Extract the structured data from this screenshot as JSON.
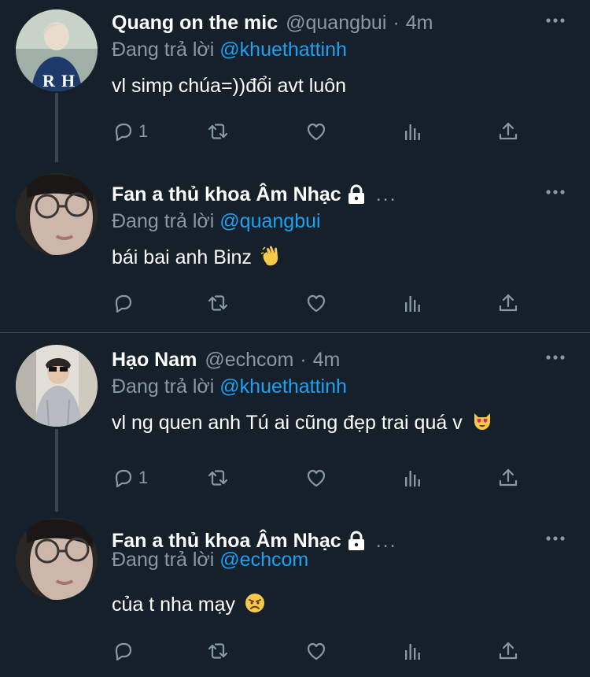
{
  "tweets": [
    {
      "name": "Quang on the mic",
      "handle": "@quangbui",
      "time": "4m",
      "reply_prefix": "Đang trả lời",
      "reply_to": "@khuethattinh",
      "text": "vl simp chúa=))đổi avt luôn",
      "reply_count": "1"
    },
    {
      "name": "Fan a thủ khoa Âm Nhạc",
      "reply_prefix": "Đang trả lời",
      "reply_to": "@quangbui",
      "text": "bái bai anh Binz",
      "reply_count": ""
    },
    {
      "name": "Hạo Nam",
      "handle": "@echcom",
      "time": "4m",
      "reply_prefix": "Đang trả lời",
      "reply_to": "@khuethattinh",
      "text": "vl ng quen anh Tú ai cũng đẹp trai quá v",
      "reply_count": "1"
    },
    {
      "name": "Fan a thủ khoa Âm Nhạc",
      "reply_prefix": "Đang trả lời",
      "reply_to": "@echcom",
      "text": "của t nha mạy",
      "reply_count": ""
    }
  ],
  "colors": {
    "background": "#15202b",
    "secondary_text": "#8899a6",
    "link": "#1da1f2",
    "divider": "#38444d"
  }
}
